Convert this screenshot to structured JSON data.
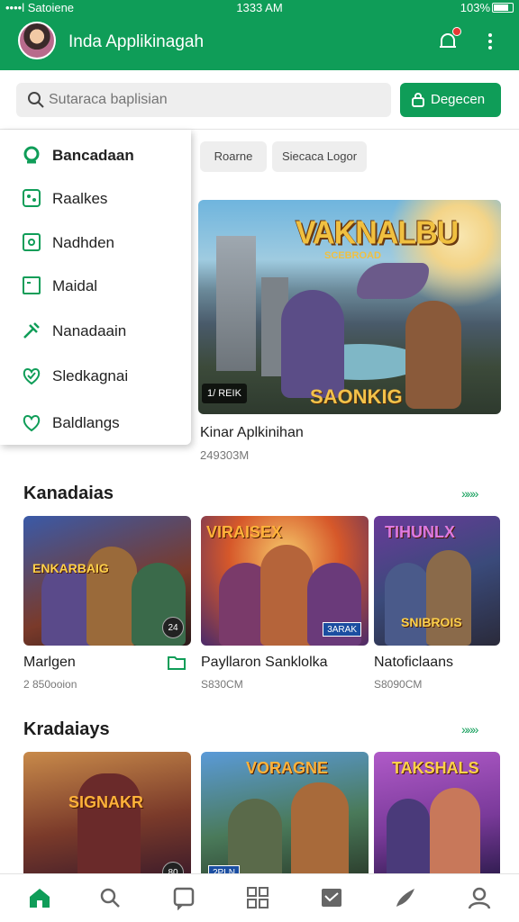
{
  "status": {
    "left": "••••l Satoiene",
    "time": "1333 AM",
    "right": "103%"
  },
  "header": {
    "title": "Inda Applikinagah",
    "accent": "#0f9d58"
  },
  "search": {
    "placeholder": "Sutaraca baplisian",
    "button": "Degecen"
  },
  "menu": [
    {
      "label": "Bancadaan",
      "icon": "search-icon",
      "active": true
    },
    {
      "label": "Raalkes",
      "icon": "grid-icon"
    },
    {
      "label": "Nadhden",
      "icon": "tag-icon"
    },
    {
      "label": "Maidal",
      "icon": "square-icon"
    },
    {
      "label": "Nanadaain",
      "icon": "tools-icon"
    },
    {
      "label": "Sledkagnai",
      "icon": "shield-heart-icon"
    },
    {
      "label": "Baldlangs",
      "icon": "heart-icon"
    }
  ],
  "chips": [
    "Roarne",
    "Siecaca Logor"
  ],
  "featured": {
    "logo": "VAKNALBU",
    "logo_sub": "SCEBROAD",
    "brand": "SAONKIG",
    "tag": "1/ REIK",
    "name": "Kinar Aplkinihan",
    "size": "249303M"
  },
  "section1": {
    "title": "Kanadaias",
    "more": "»»»",
    "cards": [
      {
        "art": "ENKARBAIG",
        "badge": "24",
        "name": "Marlgen",
        "size": "2 850ooion"
      },
      {
        "art": "VIRAISEX",
        "badge": "3ARAK",
        "name": "Payllaron Sanklolka",
        "size": "S830CM"
      },
      {
        "art": "TIHUNLX",
        "art2": "SNIBROIS",
        "name": "Natoficlaans",
        "size": "S8090CM"
      }
    ]
  },
  "section2": {
    "title": "Kradaiays",
    "more": "»»»",
    "cards": [
      {
        "art": "SIGNAKR",
        "badge": "80"
      },
      {
        "art": "VORAGNE",
        "badge": "2PLN"
      },
      {
        "art": "TAKSHALS",
        "badge": ""
      }
    ]
  },
  "nav": [
    "home-icon",
    "search-icon",
    "chat-icon",
    "apps-icon",
    "mail-icon",
    "brush-icon",
    "profile-icon"
  ]
}
